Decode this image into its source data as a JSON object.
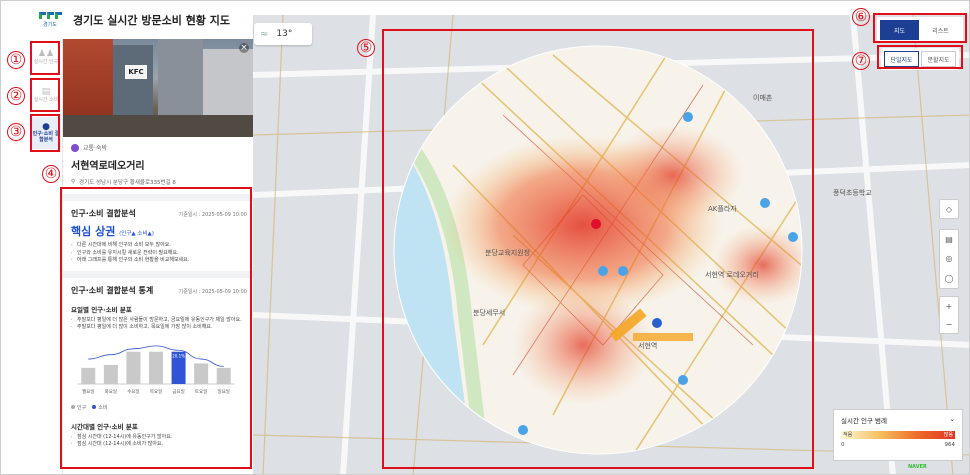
{
  "app": {
    "title": "경기도 실시간 방문소비 현황 지도",
    "logo_text": "경기도"
  },
  "rail": {
    "items": [
      {
        "label": "실시간 인구",
        "icon": "people-icon",
        "active": false
      },
      {
        "label": "실시간 소비",
        "icon": "store-icon",
        "active": false
      },
      {
        "label": "인구·소비 결합분석",
        "icon": "person-group-icon",
        "active": true
      }
    ]
  },
  "annotations": [
    "①",
    "②",
    "③",
    "④",
    "⑤",
    "⑥",
    "⑦"
  ],
  "place": {
    "category": "교통·숙박",
    "name": "서현역로데오거리",
    "address": "경기도 성남시 분당구 황새울로335번길 8",
    "photo_sign": "KFC"
  },
  "analysis": {
    "title": "인구·소비 결합분석",
    "date": "기준일시 : 2025-05-09 10:00",
    "result": "핵심 상권",
    "result_tag": "(인구▲ 소비▲)",
    "bullets": [
      "다른 시간대에 비해 인구와 소비 모두 많아요.",
      "인구와 소비를 유지시킬 새로운 전략이 필요해요.",
      "아래 그래프를 통해 인구와 소비 현황을 비교해보세요."
    ]
  },
  "stats": {
    "title": "인구·소비 결합분석 통계",
    "date": "기준일시 : 2025-05-09 10:00",
    "weekday_title": "요일별 인구·소비 분포",
    "weekday_bullets": [
      "주말보다 평일에 더 많은 사람들이 방문하고, 금요일에 유동인구가 제일 많아요.",
      "주말보다 평일에 더 많이 소비하고, 목요일에 가장 많이 소비해요."
    ],
    "legend": {
      "population": "인구",
      "consumption": "소비"
    },
    "time_title": "시간대별 인구·소비 분포",
    "time_bullets": [
      "점심 시간대 (12-14시)에 유동인구가 많아요.",
      "점심 시간대 (12-14시)에 소비가 많아요."
    ]
  },
  "chart_data": {
    "type": "bar",
    "categories": [
      "월요일",
      "화요일",
      "수요일",
      "목요일",
      "금요일",
      "토요일",
      "일요일"
    ],
    "series": [
      {
        "name": "인구",
        "values": [
          11,
          13,
          22,
          22,
          22,
          14,
          11
        ]
      },
      {
        "name": "소비",
        "values": [
          17,
          20,
          24,
          26,
          23,
          17,
          12
        ]
      }
    ],
    "highlight_index": 4,
    "highlight_label": "20.1%",
    "ylim": [
      0,
      30
    ],
    "colors": {
      "bar": "#c9c9c9",
      "highlight": "#2f55d4",
      "line": "#2f55d4"
    }
  },
  "map": {
    "temperature": "13°",
    "view_toggle": {
      "options": [
        "지도",
        "리스트"
      ],
      "selected": "지도"
    },
    "map_toggle": {
      "options": [
        "단일지도",
        "분할지도"
      ],
      "selected": "단일지도"
    },
    "labels": [
      "서현역 로데오거리",
      "서현역",
      "분당교육지원청",
      "AK플라자",
      "이매촌",
      "풍덕초등학교",
      "분당세무서"
    ],
    "legend": {
      "title": "실시간 인구 범례",
      "low": "적음",
      "high": "많음",
      "min": "0",
      "max": "964"
    },
    "attribution": "NAVER"
  },
  "colors": {
    "accent": "#1c3f94",
    "annotation": "#e0101a",
    "heat_high": "#e23322"
  }
}
